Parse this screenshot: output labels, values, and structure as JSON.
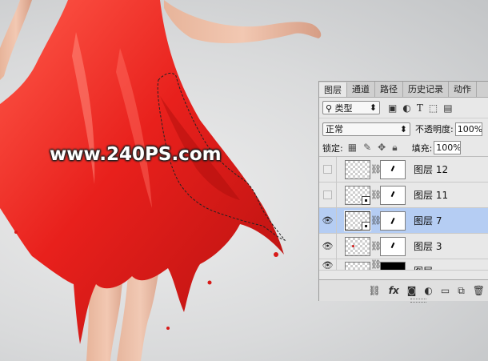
{
  "watermark": "www.240PS.com",
  "layers_panel": {
    "tabs": [
      {
        "label": "图层",
        "active": true
      },
      {
        "label": "通道",
        "active": false
      },
      {
        "label": "路径",
        "active": false
      },
      {
        "label": "历史记录",
        "active": false
      },
      {
        "label": "动作",
        "active": false
      }
    ],
    "filter": {
      "label": "类型",
      "search_icon": "search-icon",
      "dropdown_icon": "updown-arrow-icon"
    },
    "filter_icons": [
      "image-filter-icon",
      "adjustment-filter-icon",
      "text-filter-icon",
      "shape-filter-icon",
      "smart-object-filter-icon"
    ],
    "blend_mode": "正常",
    "opacity_label": "不透明度:",
    "opacity_value": "100%",
    "lock_label": "锁定:",
    "lock_icons": [
      "lock-transparent-icon",
      "lock-paint-icon",
      "lock-move-icon",
      "lock-all-icon"
    ],
    "fill_label": "填充:",
    "fill_value": "100%",
    "layers": [
      {
        "name": "图层 12",
        "visible": false,
        "selected": false,
        "smart": false,
        "mask": "white"
      },
      {
        "name": "图层 11",
        "visible": false,
        "selected": false,
        "smart": true,
        "mask": "white"
      },
      {
        "name": "图层 7",
        "visible": true,
        "selected": true,
        "smart": true,
        "mask": "white"
      },
      {
        "name": "图层 3",
        "visible": true,
        "selected": false,
        "smart": false,
        "mask": "white"
      },
      {
        "name": "图层",
        "visible": true,
        "selected": false,
        "smart": false,
        "mask": "black"
      }
    ],
    "bottom_icons": [
      "link-layers-icon",
      "fx-icon",
      "add-mask-icon",
      "adjustment-layer-icon",
      "new-group-icon",
      "new-layer-icon",
      "delete-icon"
    ],
    "bottom_glyphs": {
      "link": "⛓",
      "fx": "fx",
      "mask": "◙",
      "adjust": "◐",
      "group": "▭",
      "new": "⧉",
      "delete": "🗑"
    }
  }
}
